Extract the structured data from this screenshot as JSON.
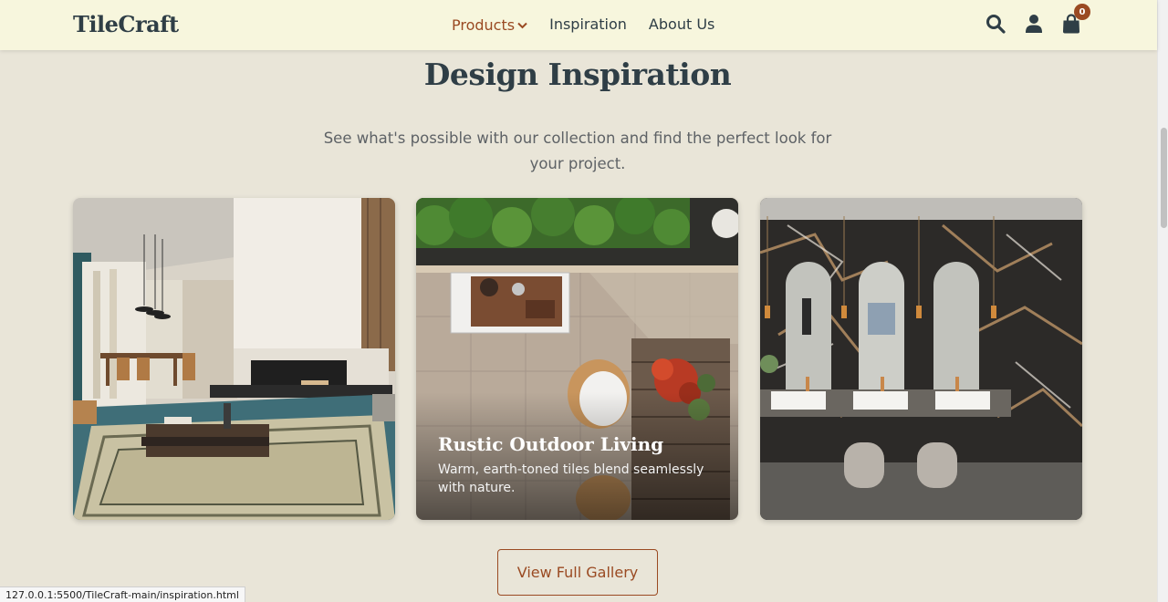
{
  "brand": {
    "name": "TileCraft"
  },
  "nav": {
    "items": [
      {
        "label": "Products",
        "active": true,
        "has_dropdown": true
      },
      {
        "label": "Inspiration",
        "active": false
      },
      {
        "label": "About Us",
        "active": false
      }
    ],
    "icons": [
      "search-icon",
      "user-icon",
      "shopping-bag-icon"
    ],
    "cart_count": "0"
  },
  "section": {
    "title": "Design Inspiration",
    "subtitle": "See what's possible with our collection and find the perfect look for your project.",
    "cards": [
      {
        "scene": "living-room-fireplace-rug"
      },
      {
        "scene": "outdoor-patio-top-view",
        "title": "Rustic Outdoor Living",
        "description": "Warm, earth-toned tiles blend seamlessly with nature."
      },
      {
        "scene": "marble-bathroom-vanity"
      }
    ],
    "cta_label": "View Full Gallery"
  },
  "status_bar": {
    "url": "127.0.0.1:5500/TileCraft-main/inspiration.html"
  },
  "colors": {
    "accent": "#9a4a22",
    "heading": "#2f3e46",
    "header_bg": "#f7f6dd",
    "page_bg": "#e9e5d8"
  }
}
